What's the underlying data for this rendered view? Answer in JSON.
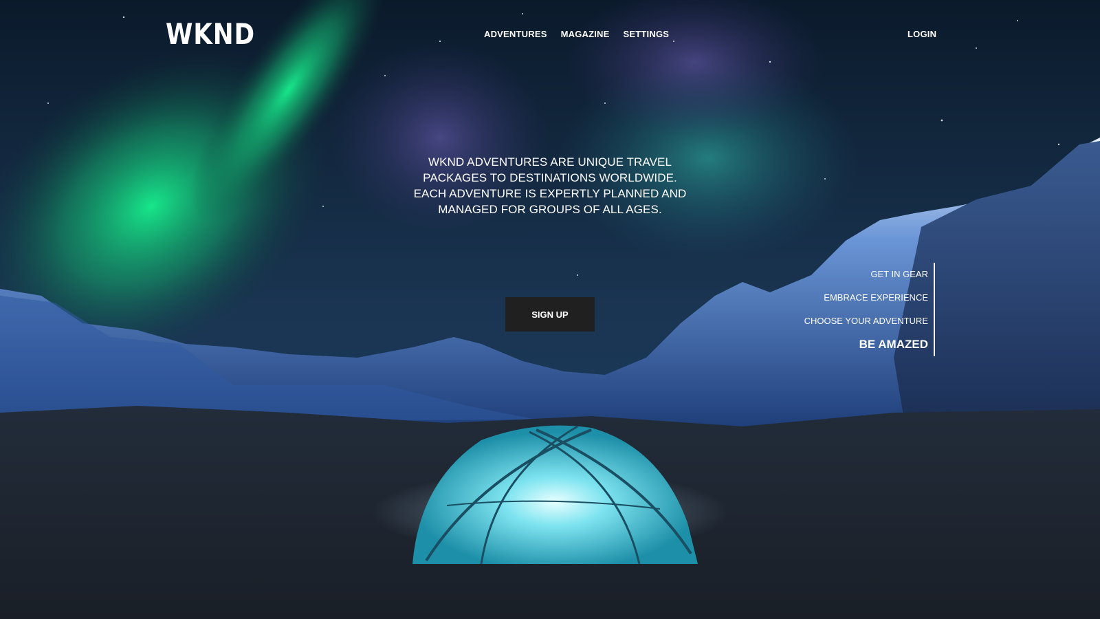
{
  "header": {
    "logo": "WKND",
    "nav": [
      {
        "label": "ADVENTURES"
      },
      {
        "label": "MAGAZINE"
      },
      {
        "label": "SETTINGS"
      }
    ],
    "login_label": "LOGIN"
  },
  "hero": {
    "lines": [
      "WKND ADVENTURES ARE UNIQUE TRAVEL",
      "PACKAGES TO DESTINATIONS WORLDWIDE.",
      "EACH ADVENTURE IS EXPERTLY PLANNED AND",
      "MANAGED FOR GROUPS OF ALL AGES."
    ],
    "signup_label": "SIGN UP"
  },
  "side_nav": {
    "items": [
      {
        "label": "GET IN GEAR"
      },
      {
        "label": "EMBRACE EXPERIENCE"
      },
      {
        "label": "CHOOSE YOUR ADVENTURE"
      },
      {
        "label": "BE AMAZED"
      }
    ],
    "active": "BE AMAZED"
  },
  "colors": {
    "text": "#ffffff",
    "button_bg": "#202020",
    "tent": "#4fd0e0",
    "aurora": "#1ee28a"
  }
}
